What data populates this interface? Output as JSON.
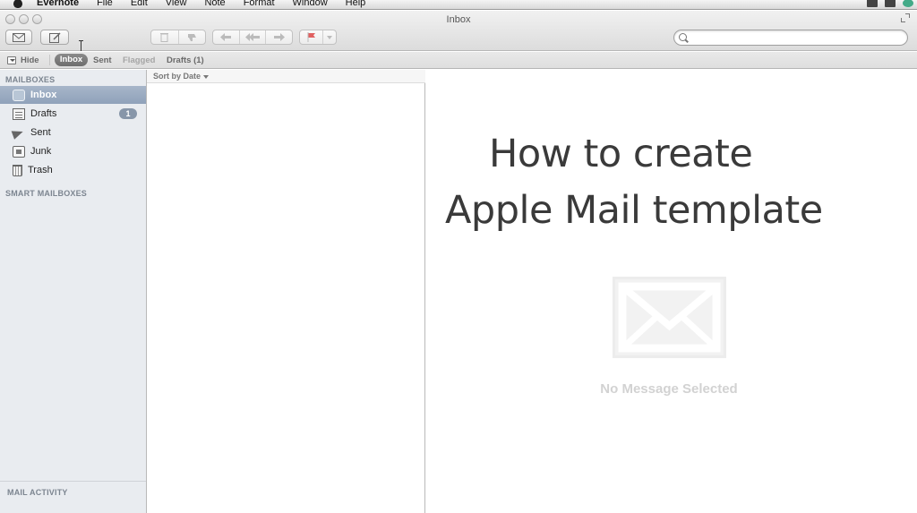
{
  "menubar": {
    "app_name": "Evernote",
    "items": [
      "File",
      "Edit",
      "View",
      "Note",
      "Format",
      "Window",
      "Help"
    ]
  },
  "window": {
    "title": "Inbox"
  },
  "search": {
    "value": "",
    "placeholder": ""
  },
  "favorites": {
    "hide_label": "Hide",
    "inbox_label": "Inbox",
    "sent_label": "Sent",
    "flagged_label": "Flagged",
    "drafts_label": "Drafts (1)"
  },
  "sidebar": {
    "mailboxes_heading": "MAILBOXES",
    "items": [
      {
        "label": "Inbox",
        "icon": "inbox-icon",
        "selected": true
      },
      {
        "label": "Drafts",
        "icon": "drafts-icon",
        "badge": "1"
      },
      {
        "label": "Sent",
        "icon": "sent-icon"
      },
      {
        "label": "Junk",
        "icon": "junk-icon"
      },
      {
        "label": "Trash",
        "icon": "trash-icon"
      }
    ],
    "smart_heading": "SMART MAILBOXES",
    "activity_heading": "MAIL ACTIVITY"
  },
  "list": {
    "sort_label": "Sort by Date"
  },
  "message": {
    "overlay_line1": "How to create",
    "overlay_line2": "Apple Mail template",
    "empty_label": "No Message Selected"
  },
  "colors": {
    "selection": "#97a8bf",
    "sidebar_bg": "#e9ecf0",
    "badge": "#8796a9"
  }
}
